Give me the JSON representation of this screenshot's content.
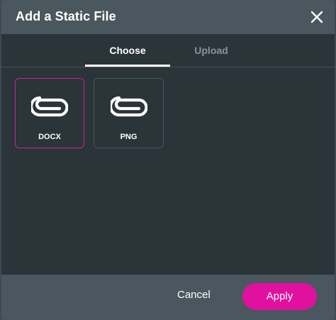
{
  "dialog": {
    "title": "Add a Static File",
    "close_icon": "close-icon"
  },
  "tabs": [
    {
      "label": "Choose",
      "active": true
    },
    {
      "label": "Upload",
      "active": false
    }
  ],
  "files": [
    {
      "label": "DOCX",
      "icon": "paperclip-icon",
      "selected": true
    },
    {
      "label": "PNG",
      "icon": "paperclip-icon",
      "selected": false
    }
  ],
  "footer": {
    "cancel_label": "Cancel",
    "apply_label": "Apply"
  },
  "colors": {
    "accent": "#e0119f",
    "selected_border": "#d81ba6",
    "header_bg": "#4b575e",
    "body_bg": "#2b3439"
  }
}
